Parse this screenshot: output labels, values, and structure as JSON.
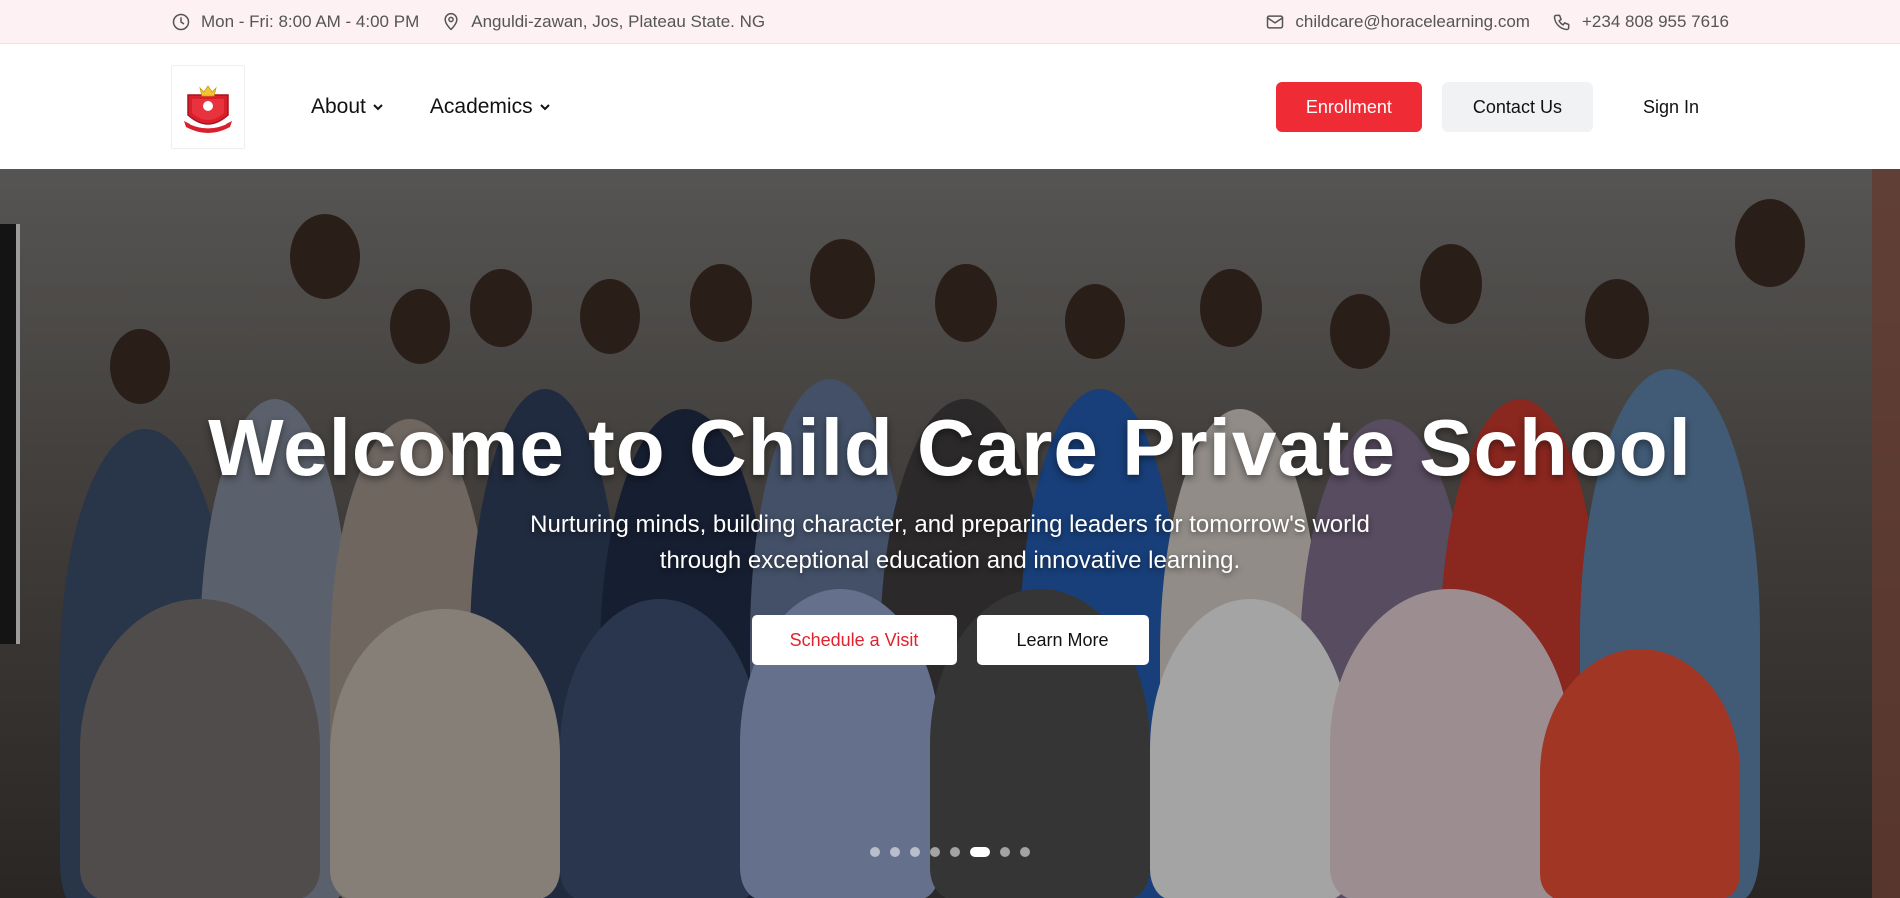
{
  "topbar": {
    "hours": "Mon - Fri: 8:00 AM - 4:00 PM",
    "address": "Anguldi-zawan, Jos, Plateau State. NG",
    "email": "childcare@horacelearning.com",
    "phone": "+234 808 955 7616",
    "icons": [
      "clock-icon",
      "map-pin-icon",
      "mail-icon",
      "phone-icon"
    ]
  },
  "nav": {
    "logo_alt": "Child Care Private School crest",
    "menu": [
      {
        "label": "About",
        "has_dropdown": true
      },
      {
        "label": "Academics",
        "has_dropdown": true
      }
    ],
    "enroll_label": "Enrollment",
    "contact_label": "Contact Us",
    "signin_label": "Sign In"
  },
  "hero": {
    "title": "Welcome to Child Care Private School",
    "subtitle": "Nurturing minds, building character, and preparing leaders for tomorrow's world through exceptional education and innovative learning.",
    "primary_cta": "Schedule a Visit",
    "secondary_cta": "Learn More",
    "carousel": {
      "total_slides": 8,
      "active_index": 5
    }
  },
  "colors": {
    "accent": "#ef2b36",
    "topbar_bg": "#fdf1f3",
    "contact_bg": "#f1f2f4"
  }
}
